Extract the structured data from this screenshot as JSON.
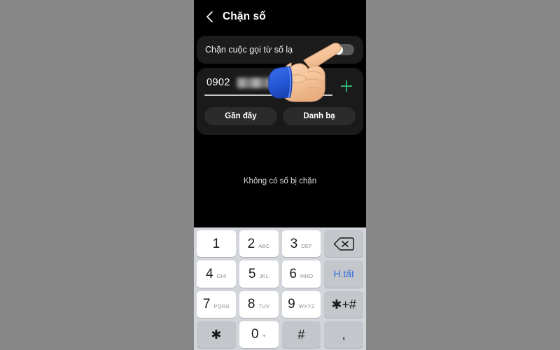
{
  "colors": {
    "page_background": "#878787",
    "screen_background": "#000000",
    "card_background": "#1c1c1c",
    "accent_green": "#34c77b",
    "accent_blue": "#2f6fd8",
    "keypad_background": "#d2d5da",
    "key_white": "#ffffff",
    "key_gray": "#c3c6cb",
    "toggle_track_off": "#5a5a5a",
    "toggle_knob": "#ffffff"
  },
  "header": {
    "back_icon": "chevron-left-icon",
    "title": "Chặn số"
  },
  "settings_row": {
    "label": "Chặn cuộc gọi từ số lạ",
    "toggle_state": "off"
  },
  "number_entry": {
    "value": "0902",
    "redacted": true,
    "add_icon": "plus-icon",
    "buttons": [
      {
        "label": "Gần đây",
        "name": "recent-button"
      },
      {
        "label": "Danh bạ",
        "name": "contacts-button"
      }
    ]
  },
  "empty_state": {
    "text": "Không có số bị chặn"
  },
  "cursor": {
    "icon": "pointing-hand-icon"
  },
  "keypad": {
    "rows": [
      [
        {
          "name": "key-1",
          "main": "1",
          "sub": "",
          "style": "white",
          "type": "digit"
        },
        {
          "name": "key-2",
          "main": "2",
          "sub": "ABC",
          "style": "white",
          "type": "digit"
        },
        {
          "name": "key-3",
          "main": "3",
          "sub": "DEF",
          "style": "white",
          "type": "digit"
        },
        {
          "name": "key-backspace",
          "main": "",
          "sub": "",
          "style": "gray",
          "type": "backspace-icon"
        }
      ],
      [
        {
          "name": "key-4",
          "main": "4",
          "sub": "GHI",
          "style": "white",
          "type": "digit"
        },
        {
          "name": "key-5",
          "main": "5",
          "sub": "JKL",
          "style": "white",
          "type": "digit"
        },
        {
          "name": "key-6",
          "main": "6",
          "sub": "MNO",
          "style": "white",
          "type": "digit"
        },
        {
          "name": "key-done",
          "main": "H.tất",
          "sub": "",
          "style": "gray",
          "type": "text"
        }
      ],
      [
        {
          "name": "key-7",
          "main": "7",
          "sub": "PQRS",
          "style": "white",
          "type": "digit"
        },
        {
          "name": "key-8",
          "main": "8",
          "sub": "TUV",
          "style": "white",
          "type": "digit"
        },
        {
          "name": "key-9",
          "main": "9",
          "sub": "WXYZ",
          "style": "white",
          "type": "digit"
        },
        {
          "name": "key-star-plus-hash",
          "main": "✱+#",
          "sub": "",
          "style": "gray",
          "type": "symbol"
        }
      ],
      [
        {
          "name": "key-star",
          "main": "✱",
          "sub": "",
          "style": "gray",
          "type": "symbol"
        },
        {
          "name": "key-0",
          "main": "0",
          "sub": "+",
          "style": "white",
          "type": "digit"
        },
        {
          "name": "key-hash",
          "main": "#",
          "sub": "",
          "style": "gray",
          "type": "symbol"
        },
        {
          "name": "key-comma",
          "main": ",",
          "sub": "",
          "style": "gray",
          "type": "symbol"
        }
      ]
    ]
  }
}
